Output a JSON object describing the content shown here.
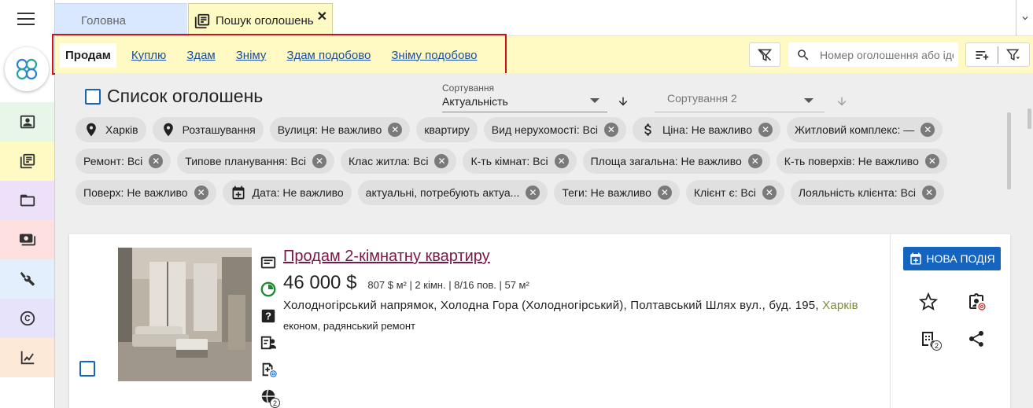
{
  "rail": {
    "menu_icon": "hamburger-icon",
    "logo_icon": "app-logo",
    "items": [
      {
        "name": "contacts",
        "icon": "contact-card-icon",
        "bg": "#e8f5e9"
      },
      {
        "name": "listings",
        "icon": "listings-icon",
        "bg": "#fff9c4"
      },
      {
        "name": "folders",
        "icon": "folder-icon",
        "bg": "#ede1fa"
      },
      {
        "name": "payments",
        "icon": "money-icon",
        "bg": "#ffe0e0"
      },
      {
        "name": "tools",
        "icon": "tools-icon",
        "bg": "#e3effd"
      },
      {
        "name": "copyright",
        "icon": "copyright-icon",
        "bg": "#e6e3fb"
      },
      {
        "name": "analytics",
        "icon": "chart-icon",
        "bg": "#fde9d8"
      }
    ]
  },
  "tabs": {
    "home_label": "Головна",
    "search_label": "Пошук оголошень",
    "close": "✕"
  },
  "deal_tabs": [
    "Продам",
    "Куплю",
    "Здам",
    "Зніму",
    "Здам подобово",
    "Зніму подобово"
  ],
  "active_deal_tab": "Продам",
  "search": {
    "placeholder": "Номер оголошення або ідентифікатор"
  },
  "list": {
    "title": "Список оголошень",
    "sort1_label": "Сортування",
    "sort1_value": "Актуальність",
    "sort2_placeholder": "Сортування 2"
  },
  "chips": [
    [
      {
        "label": "Харків",
        "icon": "location-icon",
        "closable": false
      },
      {
        "label": "Розташування",
        "icon": "location-icon",
        "closable": false
      },
      {
        "label": "Вулиця: Не важливо",
        "icon": "",
        "closable": true
      },
      {
        "label": "квартиру",
        "icon": "",
        "closable": false
      },
      {
        "label": "Вид нерухомості: Всі",
        "icon": "",
        "closable": true
      },
      {
        "label": "Ціна: Не важливо",
        "icon": "dollar-icon",
        "closable": true
      },
      {
        "label": "Житловий комплекс: —",
        "icon": "",
        "closable": true
      }
    ],
    [
      {
        "label": "Ремонт: Всі",
        "icon": "",
        "closable": true
      },
      {
        "label": "Типове планування: Всі",
        "icon": "",
        "closable": true
      },
      {
        "label": "Клас житла: Всі",
        "icon": "",
        "closable": true
      },
      {
        "label": "К-ть кімнат: Всі",
        "icon": "",
        "closable": true
      },
      {
        "label": "Площа загальна: Не важливо",
        "icon": "",
        "closable": true
      },
      {
        "label": "К-ть поверхів: Не важливо",
        "icon": "",
        "closable": true
      }
    ],
    [
      {
        "label": "Поверх: Не важливо",
        "icon": "",
        "closable": true
      },
      {
        "label": "Дата: Не важливо",
        "icon": "calendar-icon",
        "closable": false
      },
      {
        "label": "актуальні, потребують актуа...",
        "icon": "",
        "closable": true
      },
      {
        "label": "Теги: Не важливо",
        "icon": "",
        "closable": true
      },
      {
        "label": "Клієнт є: Всі",
        "icon": "",
        "closable": true
      },
      {
        "label": "Лояльність клієнта: Всі",
        "icon": "",
        "closable": true
      }
    ]
  ],
  "listing": {
    "title": "Продам 2-кімнатну квартиру",
    "price": "46 000 $",
    "price_meta": "807 $ м² | 2 кімн. | 8/16 пов. | 57 м²",
    "address": "Холодногірський напрямок, Холодна Гора (Холодногірський), Полтавський Шлях вул., буд. 195, ",
    "city": "Харків",
    "details": "економ, радянський ремонт",
    "new_event_label": "НОВА ПОДІЯ",
    "badge_docs": "2",
    "badge_web": "2"
  },
  "colors": {
    "accent": "#1565c0",
    "toolbar_bg": "#fff9c4",
    "listing_title": "#7b1747",
    "highlight": "#d0111a"
  }
}
